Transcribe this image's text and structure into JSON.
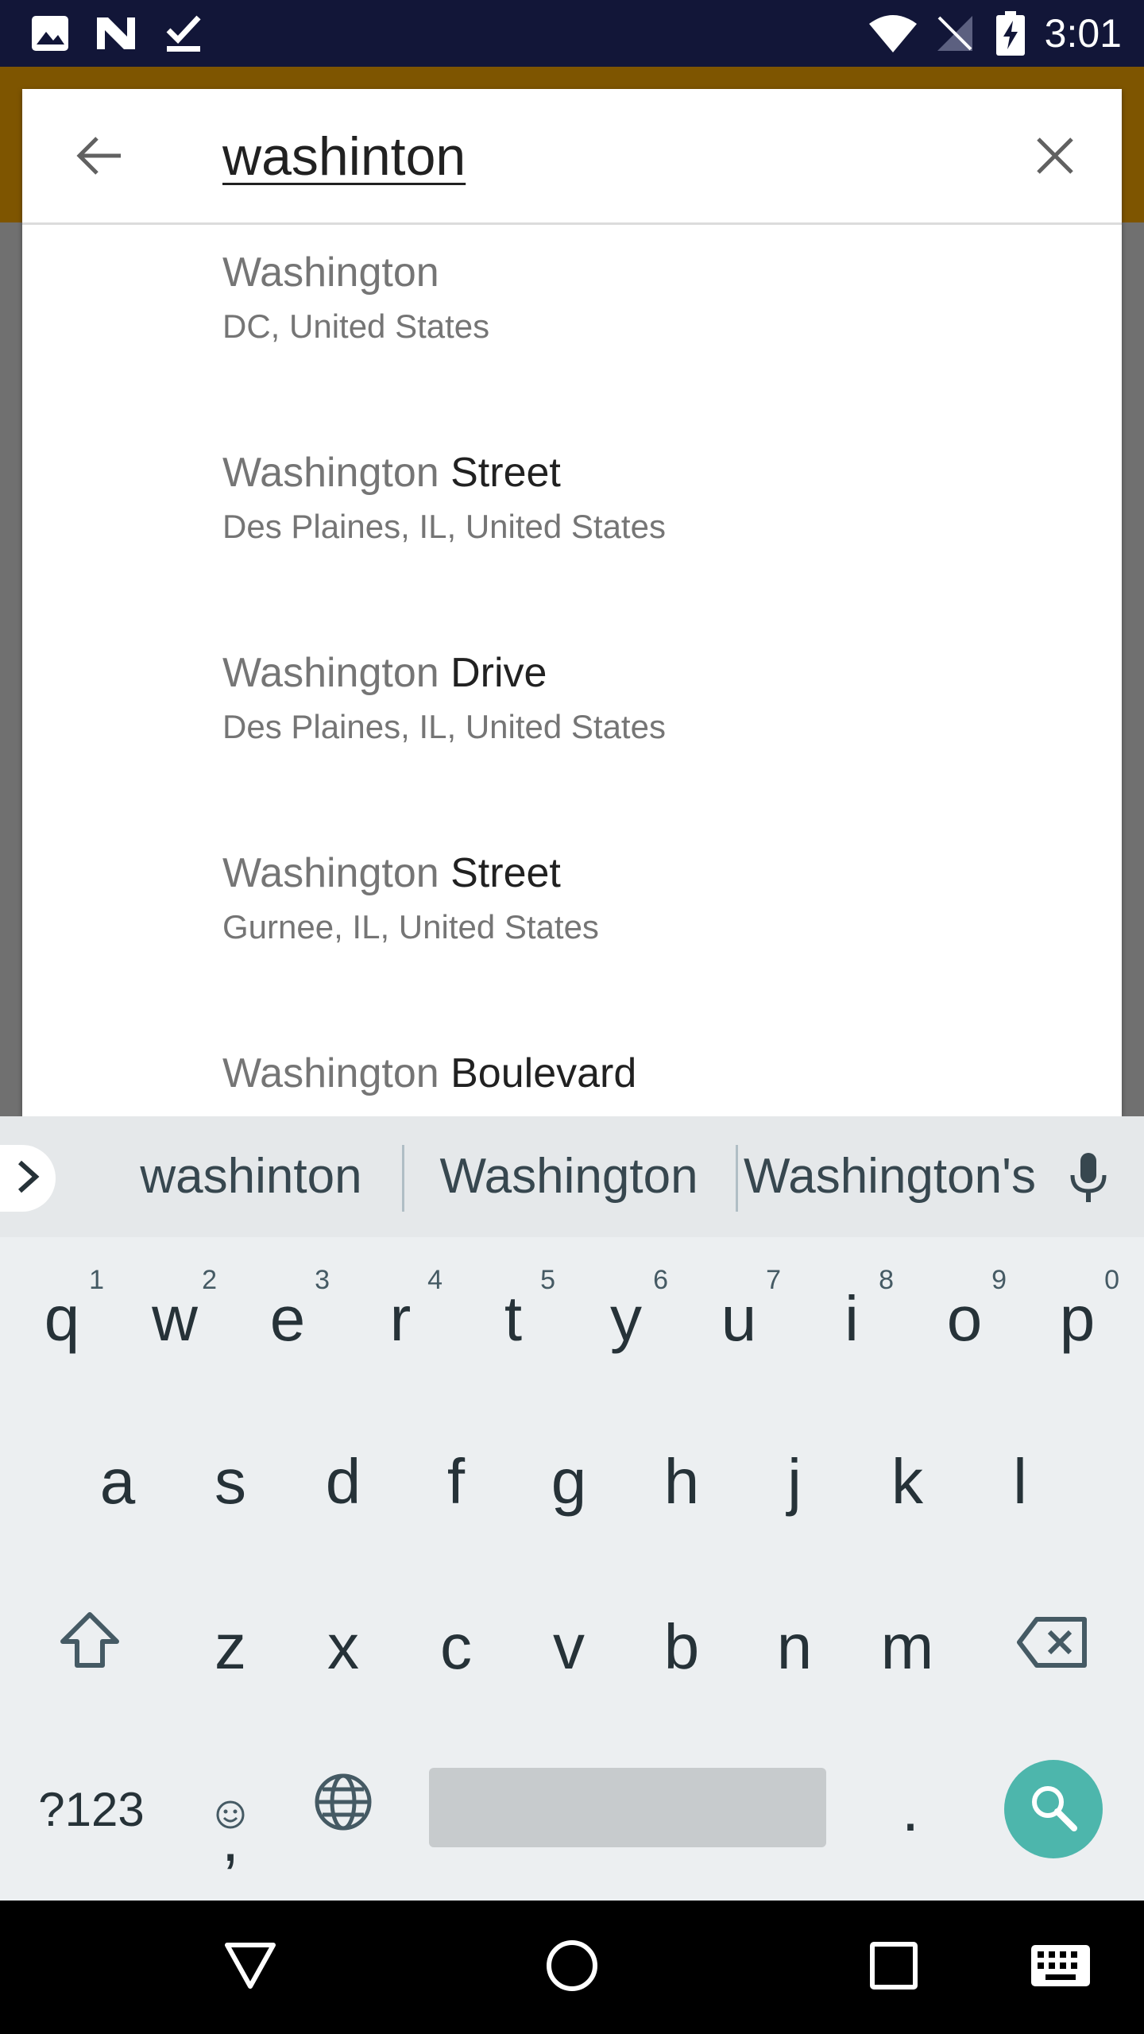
{
  "status_bar": {
    "time": "3:01",
    "left_icons": [
      "image-icon",
      "n-logo-icon",
      "checkmark-download-icon"
    ],
    "right_icons": [
      "wifi-icon",
      "no-signal-icon",
      "battery-charging-icon"
    ]
  },
  "search": {
    "query": "washinton",
    "back_icon": "arrow-left-icon",
    "clear_icon": "close-icon"
  },
  "results": [
    {
      "match": "Washington",
      "rest": "",
      "subtitle": "DC, United States"
    },
    {
      "match": "Washington",
      "rest": " Street",
      "subtitle": "Des Plaines, IL, United States"
    },
    {
      "match": "Washington",
      "rest": " Drive",
      "subtitle": "Des Plaines, IL, United States"
    },
    {
      "match": "Washington",
      "rest": " Street",
      "subtitle": "Gurnee, IL, United States"
    },
    {
      "match": "Washington",
      "rest": " Boulevard",
      "subtitle": ""
    }
  ],
  "keyboard": {
    "suggestions": [
      "washinton",
      "Washington",
      "Washington's"
    ],
    "row1": [
      {
        "key": "q",
        "hint": "1"
      },
      {
        "key": "w",
        "hint": "2"
      },
      {
        "key": "e",
        "hint": "3"
      },
      {
        "key": "r",
        "hint": "4"
      },
      {
        "key": "t",
        "hint": "5"
      },
      {
        "key": "y",
        "hint": "6"
      },
      {
        "key": "u",
        "hint": "7"
      },
      {
        "key": "i",
        "hint": "8"
      },
      {
        "key": "o",
        "hint": "9"
      },
      {
        "key": "p",
        "hint": "0"
      }
    ],
    "row2": [
      "a",
      "s",
      "d",
      "f",
      "g",
      "h",
      "j",
      "k",
      "l"
    ],
    "row3": [
      "z",
      "x",
      "c",
      "v",
      "b",
      "n",
      "m"
    ],
    "symbols_label": "?123",
    "comma_label": ",",
    "period_label": ".",
    "accent_color": "#4db6ac"
  },
  "colors": {
    "status_bar": "#121638",
    "app_header": "#7e5500",
    "overlay": "#707070"
  }
}
